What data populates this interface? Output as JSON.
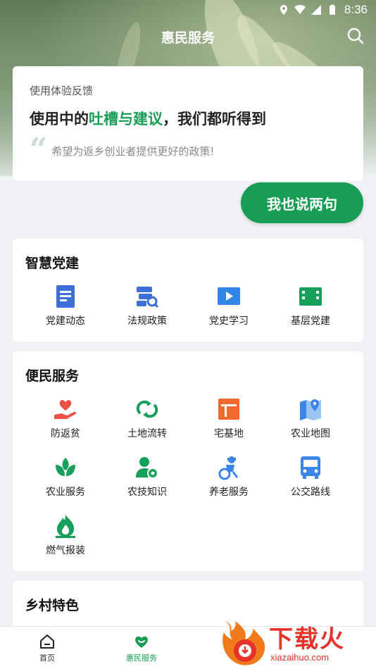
{
  "status_bar": {
    "time": "8:36"
  },
  "header": {
    "title": "惠民服务"
  },
  "feedback": {
    "small_title": "使用体验反馈",
    "headline_pre": "使用中的",
    "headline_highlight": "吐槽与建议",
    "headline_post": "，我们都听得到",
    "quote": "希望为返乡创业者提供更好的政策!",
    "button": "我也说两句"
  },
  "sections": {
    "party": {
      "title": "智慧党建",
      "items": [
        {
          "label": "党建动态",
          "icon": "document-icon",
          "color": "#3c6fd8"
        },
        {
          "label": "法规政策",
          "icon": "law-search-icon",
          "color": "#3c6fd8"
        },
        {
          "label": "党史学习",
          "icon": "video-play-icon",
          "color": "#2f86e6"
        },
        {
          "label": "基层党建",
          "icon": "building-icon",
          "color": "#17a05a"
        }
      ]
    },
    "services": {
      "title": "便民服务",
      "items": [
        {
          "label": "防返贫",
          "icon": "heart-hand-icon",
          "color": "#f0504a"
        },
        {
          "label": "土地流转",
          "icon": "transfer-icon",
          "color": "#17a05a"
        },
        {
          "label": "宅基地",
          "icon": "homestead-icon",
          "color": "#f26a2e"
        },
        {
          "label": "农业地图",
          "icon": "map-pin-icon",
          "color": "#3c86e8"
        },
        {
          "label": "农业服务",
          "icon": "sprout-icon",
          "color": "#17a05a"
        },
        {
          "label": "农技知识",
          "icon": "expert-icon",
          "color": "#17a05a"
        },
        {
          "label": "养老服务",
          "icon": "elderly-icon",
          "color": "#3c86e8"
        },
        {
          "label": "公交路线",
          "icon": "bus-icon",
          "color": "#3c86e8"
        },
        {
          "label": "燃气报装",
          "icon": "gas-flame-icon",
          "color": "#17a05a"
        }
      ]
    },
    "village": {
      "title": "乡村特色"
    }
  },
  "tabbar": {
    "items": [
      {
        "label": "首页",
        "icon": "home-icon"
      },
      {
        "label": "惠民服务",
        "icon": "heart-service-icon",
        "active": true
      }
    ]
  },
  "watermark": {
    "text": "下载火",
    "url": "xiazaihuo.com"
  },
  "colors": {
    "accent": "#179e54",
    "background": "#f1f2f6"
  }
}
